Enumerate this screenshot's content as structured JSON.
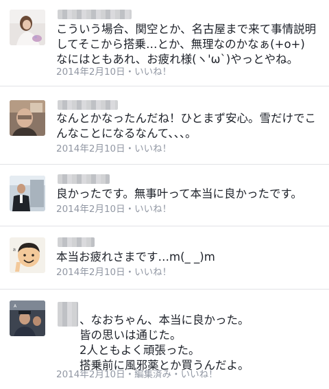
{
  "comments": [
    {
      "text": "こういう場合、関空とか、名古屋まで来て事情説明してそこから搭乗…とか、無理なのかなぁ(+o+)\nなにはともあれ、お疲れ様(ヽ'ω`)やっとやね。",
      "date": "2014年2月10日",
      "separator": "・",
      "like": "いいね！"
    },
    {
      "text": "なんとかなったんだね！ひとまず安心。雪だけでこんなことになるなんて、、、。",
      "date": "2014年2月10日",
      "separator": "・",
      "like": "いいね！"
    },
    {
      "text": "良かったです。無事叶って本当に良かったです。",
      "date": "2014年2月10日",
      "separator": "・",
      "like": "いいね！"
    },
    {
      "text": "本当お疲れさまです…m(_ _)m",
      "date": "2014年2月10日",
      "separator": "・",
      "like": "いいね！"
    },
    {
      "text": "、なおちゃん、本当に良かった。\n皆の思いは通じた。\n2人ともよく頑張った。\n搭乗前に風邪薬とか買うんだよ。",
      "date": "2014年2月10日",
      "separator": "・",
      "edited": "編集済み",
      "like": "いいね！"
    }
  ]
}
